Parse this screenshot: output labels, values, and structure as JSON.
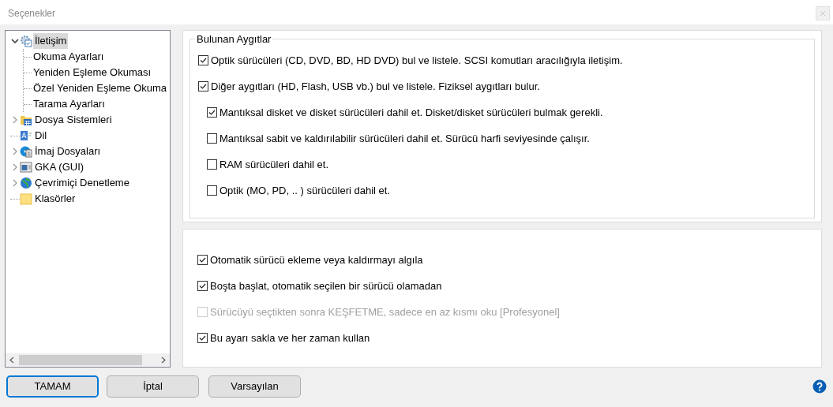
{
  "window": {
    "title": "Seçenekler"
  },
  "tree": {
    "items": [
      {
        "label": "İletişim",
        "kind": "group",
        "expanded": true,
        "selected": true,
        "children": [
          {
            "label": "Okuma Ayarları",
            "selected": false
          },
          {
            "label": "Yeniden Eşleme Okuması",
            "selected": false
          },
          {
            "label": "Özel Yeniden Eşleme Okuma",
            "selected": false
          },
          {
            "label": "Tarama Ayarları",
            "selected": false
          }
        ]
      },
      {
        "label": "Dosya Sistemleri",
        "kind": "group",
        "expanded": false,
        "selected": false
      },
      {
        "label": "Dil",
        "kind": "leaf",
        "selected": false
      },
      {
        "label": "İmaj Dosyaları",
        "kind": "group",
        "expanded": false,
        "selected": false
      },
      {
        "label": "GKA (GUI)",
        "kind": "group",
        "expanded": false,
        "selected": false
      },
      {
        "label": "Çevrimiçi Denetleme",
        "kind": "group",
        "expanded": false,
        "selected": false
      },
      {
        "label": "Klasörler",
        "kind": "leaf",
        "selected": false
      }
    ]
  },
  "devices_group": {
    "title": "Bulunan Aygıtlar",
    "options": [
      {
        "label": "Optik sürücüleri (CD, DVD, BD, HD DVD) bul ve listele. SCSI komutları aracılığıyla iletişim.",
        "checked": true,
        "disabled": false
      },
      {
        "label": "Diğer aygıtları (HD, Flash, USB vb.) bul ve listele. Fiziksel aygıtları bulur.",
        "checked": true,
        "disabled": false,
        "children": [
          {
            "label": "Mantıksal disket ve disket sürücüleri dahil et.  Disket/disket sürücüleri bulmak gerekli.",
            "checked": true,
            "disabled": false
          },
          {
            "label": "Mantıksal sabit ve kaldırılabilir sürücüleri dahil et.  Sürücü harfi seviyesinde çalışır.",
            "checked": false,
            "disabled": false
          },
          {
            "label": "RAM sürücüleri dahil et.",
            "checked": false,
            "disabled": false
          },
          {
            "label": "Optik (MO, PD, .. ) sürücüleri dahil et.",
            "checked": false,
            "disabled": false
          }
        ]
      }
    ]
  },
  "general_group": {
    "options": [
      {
        "label": "Otomatik sürücü ekleme veya kaldırmayı algıla",
        "checked": true,
        "disabled": false
      },
      {
        "label": "Boşta başlat, otomatik seçilen bir sürücü olamadan",
        "checked": true,
        "disabled": false
      },
      {
        "label": "Sürücüyü seçtikten sonra KEŞFETME, sadece en az kısmı oku [Profesyonel]",
        "checked": false,
        "disabled": true
      },
      {
        "label": "Bu ayarı sakla ve her zaman kullan",
        "checked": true,
        "disabled": false
      }
    ]
  },
  "buttons": [
    {
      "label": "TAMAM",
      "selected": true
    },
    {
      "label": "İptal",
      "selected": false
    },
    {
      "label": "Varsayılan",
      "selected": false
    }
  ]
}
